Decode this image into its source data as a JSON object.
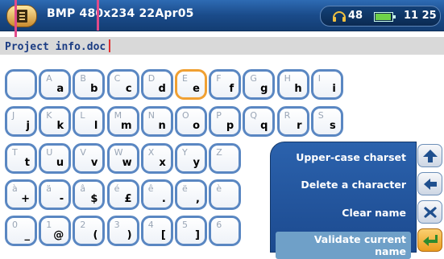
{
  "header": {
    "title": "BMP 480x234 22Apr05",
    "volume": "48",
    "battery_level": 0.85,
    "time": "11 25"
  },
  "name_field": {
    "value": "Project info.doc"
  },
  "keyboard": {
    "keys": [
      [
        {
          "s": "",
          "m": ""
        },
        {
          "s": "A",
          "m": "a"
        },
        {
          "s": "B",
          "m": "b"
        },
        {
          "s": "C",
          "m": "c"
        },
        {
          "s": "D",
          "m": "d"
        },
        {
          "s": "E",
          "m": "e",
          "selected": true
        },
        {
          "s": "F",
          "m": "f"
        },
        {
          "s": "G",
          "m": "g"
        },
        {
          "s": "H",
          "m": "h"
        },
        {
          "s": "I",
          "m": "i"
        }
      ],
      [
        {
          "s": "J",
          "m": "j"
        },
        {
          "s": "K",
          "m": "k"
        },
        {
          "s": "L",
          "m": "l"
        },
        {
          "s": "M",
          "m": "m"
        },
        {
          "s": "N",
          "m": "n"
        },
        {
          "s": "O",
          "m": "o"
        },
        {
          "s": "P",
          "m": "p"
        },
        {
          "s": "Q",
          "m": "q"
        },
        {
          "s": "R",
          "m": "r"
        },
        {
          "s": "S",
          "m": "s"
        }
      ],
      [
        {
          "s": "T",
          "m": "t"
        },
        {
          "s": "U",
          "m": "u"
        },
        {
          "s": "V",
          "m": "v"
        },
        {
          "s": "W",
          "m": "w"
        },
        {
          "s": "X",
          "m": "x"
        },
        {
          "s": "Y",
          "m": "y"
        },
        {
          "s": "Z",
          "m": ""
        }
      ],
      [
        {
          "s": "à",
          "m": "+"
        },
        {
          "s": "ä",
          "m": "-"
        },
        {
          "s": "â",
          "m": "$"
        },
        {
          "s": "é",
          "m": "£"
        },
        {
          "s": "ê",
          "m": "."
        },
        {
          "s": "ë",
          "m": ","
        },
        {
          "s": "è",
          "m": ""
        }
      ],
      [
        {
          "s": "0",
          "m": "_"
        },
        {
          "s": "1",
          "m": "@"
        },
        {
          "s": "2",
          "m": "("
        },
        {
          "s": "3",
          "m": ")"
        },
        {
          "s": "4",
          "m": "["
        },
        {
          "s": "5",
          "m": "]"
        },
        {
          "s": "6",
          "m": ""
        }
      ]
    ]
  },
  "menu": {
    "items": [
      {
        "label": "Upper-case charset",
        "icon": "arrow-up-icon"
      },
      {
        "label": "Delete a character",
        "icon": "arrow-left-icon"
      },
      {
        "label": "Clear name",
        "icon": "x-icon"
      },
      {
        "label": "Validate current name",
        "icon": "enter-icon",
        "active": true
      }
    ]
  },
  "colors": {
    "header_bg": "#1a4b8a",
    "key_border": "#5a87c2",
    "key_selected_border": "#f0a032",
    "menu_bg": "#2b62ad",
    "name_text": "#1b3c83"
  }
}
